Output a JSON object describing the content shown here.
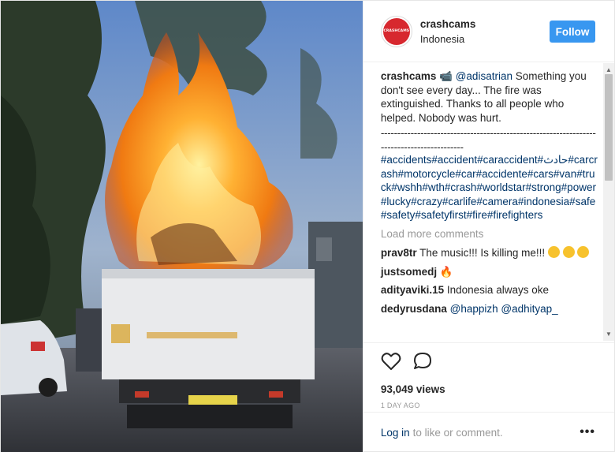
{
  "post": {
    "username": "crashcams",
    "location": "Indonesia",
    "follow_label": "Follow",
    "avatar_text": "CRASHCAMS",
    "caption": {
      "author": "crashcams",
      "mention": "@adisatrian",
      "text": "Something you don't see every day... The fire was extinguished. Thanks to all people who helped. Nobody was hurt.",
      "dashes": "------------------------------------------------------------------------------------------",
      "hashtags": "#accidents#accident#caraccident#حادث#carcrash#motorcycle#car#accidente#cars#van#truck#wshh#wth#crash#worldstar#strong#power#lucky#crazy#carlife#camera#indonesia#safe#safety#safetyfirst#fire#firefighters"
    },
    "load_more": "Load more comments",
    "comments": [
      {
        "author": "prav8tr",
        "text": "The music!!! Is killing me!!!"
      },
      {
        "author": "justsomedj",
        "text": ""
      },
      {
        "author": "adityaviki.15",
        "text": "Indonesia always oke"
      },
      {
        "author": "dedyrusdana",
        "mention1": "@happizh",
        "mention2": "@adhityap_"
      }
    ],
    "views": "93,049 views",
    "date": "1 DAY AGO",
    "login_link": "Log in",
    "login_text": "to like or comment.",
    "more_label": "•••"
  },
  "icons": {
    "like": "heart-icon",
    "comment": "comment-icon",
    "more": "more-options-icon",
    "emoji_laugh": "tears-of-joy-emoji",
    "emoji_fire": "fire-emoji"
  },
  "colors": {
    "accent": "#3897f0",
    "link": "#003569",
    "muted": "#999999",
    "brand": "#d7282f"
  }
}
